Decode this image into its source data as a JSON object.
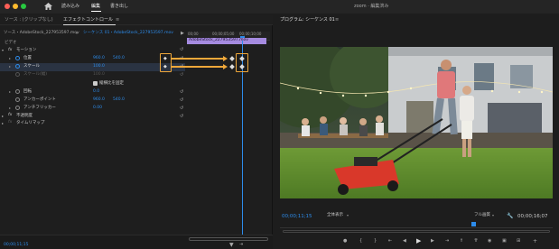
{
  "topbar": {
    "nav": [
      "読み込み",
      "編集",
      "書き出し"
    ],
    "active_nav": "編集",
    "center_title": "zoom · 編集済み"
  },
  "effect_controls": {
    "tab_source": "ソース : (クリップなし)",
    "tab_effects": "エフェクトコントロール",
    "menu_glyph": "≡",
    "breadcrumb_master": "ソース・AdobeStock_227953597.mov",
    "breadcrumb_seq": "シーケンス 01・AdobeStock_227953597.mov",
    "section_video": "ビデオ",
    "motion_label": "モーション",
    "props": [
      {
        "label": "位置",
        "v1": "960.0",
        "v2": "540.0"
      },
      {
        "label": "スケール",
        "v1": "100.0",
        "v2": ""
      },
      {
        "label": "スケール(幅)",
        "v1": "100.0",
        "v2": ""
      }
    ],
    "uniform_scale_label": "縦横比を固定",
    "more_props": [
      {
        "label": "回転",
        "v1": "0.0",
        "v2": ""
      },
      {
        "label": "アンカーポイント",
        "v1": "960.0",
        "v2": "540.0"
      },
      {
        "label": "アンチフリッカー",
        "v1": "0.00",
        "v2": ""
      }
    ],
    "opacity_label": "不透明度",
    "time_remap_label": "タイムリマップ",
    "bottom_timecode": "00;00;11;15",
    "timeline_ruler": [
      "00;00",
      "00;00;05;00",
      "00;00;10;00"
    ],
    "clip_name": "AdobeStock_227953597.mov"
  },
  "program_monitor": {
    "title": "プログラム: シーケンス 01",
    "menu_glyph": "≡",
    "current_time": "00;00;11;15",
    "fit_label": "全体表示",
    "quality_label": "フル画質",
    "duration": "00;00;16;07"
  },
  "colors": {
    "accent_blue": "#2d8ceb",
    "highlight_orange": "#f0a83a",
    "clip_purple": "#a58be0"
  }
}
